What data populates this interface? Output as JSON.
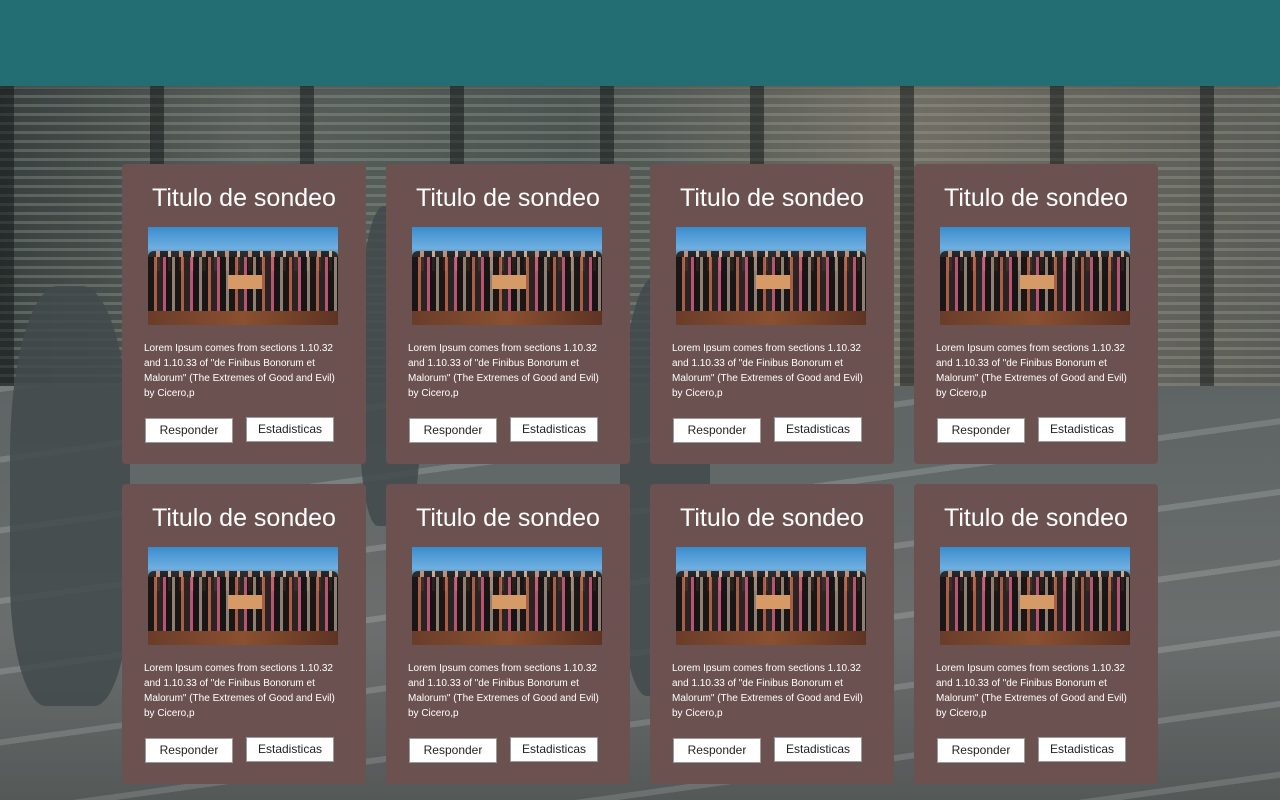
{
  "cards": [
    {
      "title": "Titulo de sondeo",
      "description": "Lorem Ipsum comes from sections 1.10.32 and 1.10.33 of \"de Finibus Bonorum et Malorum\" (The Extremes of Good and Evil) by Cicero,p",
      "respond_label": "Responder",
      "stats_label": "Estadisticas"
    },
    {
      "title": "Titulo de sondeo",
      "description": "Lorem Ipsum comes from sections 1.10.32 and 1.10.33 of \"de Finibus Bonorum et Malorum\" (The Extremes of Good and Evil) by Cicero,p",
      "respond_label": "Responder",
      "stats_label": "Estadisticas"
    },
    {
      "title": "Titulo de sondeo",
      "description": "Lorem Ipsum comes from sections 1.10.32 and 1.10.33 of \"de Finibus Bonorum et Malorum\" (The Extremes of Good and Evil) by Cicero,p",
      "respond_label": "Responder",
      "stats_label": "Estadisticas"
    },
    {
      "title": "Titulo de sondeo",
      "description": "Lorem Ipsum comes from sections 1.10.32 and 1.10.33 of \"de Finibus Bonorum et Malorum\" (The Extremes of Good and Evil) by Cicero,p",
      "respond_label": "Responder",
      "stats_label": "Estadisticas"
    },
    {
      "title": "Titulo de sondeo",
      "description": "Lorem Ipsum comes from sections 1.10.32 and 1.10.33 of \"de Finibus Bonorum et Malorum\" (The Extremes of Good and Evil) by Cicero,p",
      "respond_label": "Responder",
      "stats_label": "Estadisticas"
    },
    {
      "title": "Titulo de sondeo",
      "description": "Lorem Ipsum comes from sections 1.10.32 and 1.10.33 of \"de Finibus Bonorum et Malorum\" (The Extremes of Good and Evil) by Cicero,p",
      "respond_label": "Responder",
      "stats_label": "Estadisticas"
    },
    {
      "title": "Titulo de sondeo",
      "description": "Lorem Ipsum comes from sections 1.10.32 and 1.10.33 of \"de Finibus Bonorum et Malorum\" (The Extremes of Good and Evil) by Cicero,p",
      "respond_label": "Responder",
      "stats_label": "Estadisticas"
    },
    {
      "title": "Titulo de sondeo",
      "description": "Lorem Ipsum comes from sections 1.10.32 and 1.10.33 of \"de Finibus Bonorum et Malorum\" (The Extremes of Good and Evil) by Cicero,p",
      "respond_label": "Responder",
      "stats_label": "Estadisticas"
    }
  ],
  "colors": {
    "header": "#236e73",
    "card_background": "#6b5150",
    "button_background": "#ffffff",
    "text_on_card": "#ffffff"
  }
}
